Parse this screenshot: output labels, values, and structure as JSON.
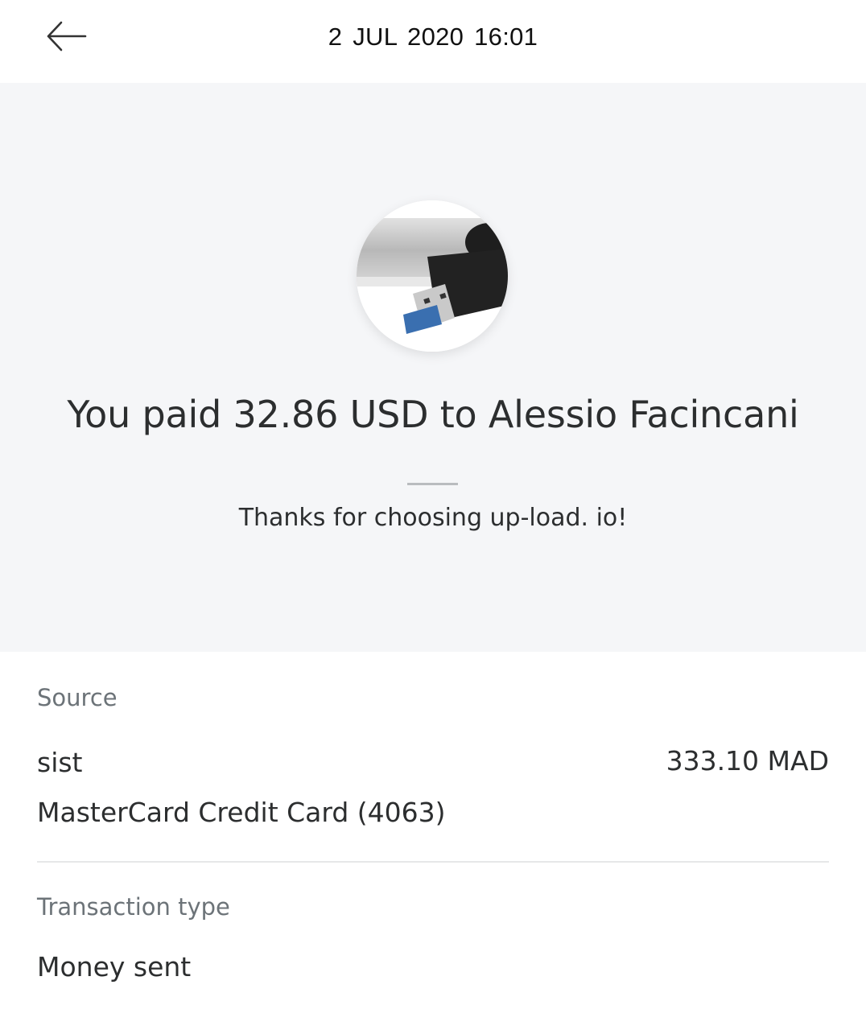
{
  "header": {
    "back_icon": "arrow-left-icon",
    "datetime": "2 JUL 2020  16:01"
  },
  "hero": {
    "merchant_image": "usb-flash-drive-photo",
    "title": "You paid 32.86 USD to Alessio Facincani",
    "note": "Thanks for choosing up-load. io!"
  },
  "details": {
    "source": {
      "label": "Source",
      "account_name": "sist",
      "amount": "333.10 MAD",
      "card": "MasterCard Credit Card (4063)"
    },
    "transaction_type": {
      "label": "Transaction type",
      "value": "Money sent"
    }
  }
}
